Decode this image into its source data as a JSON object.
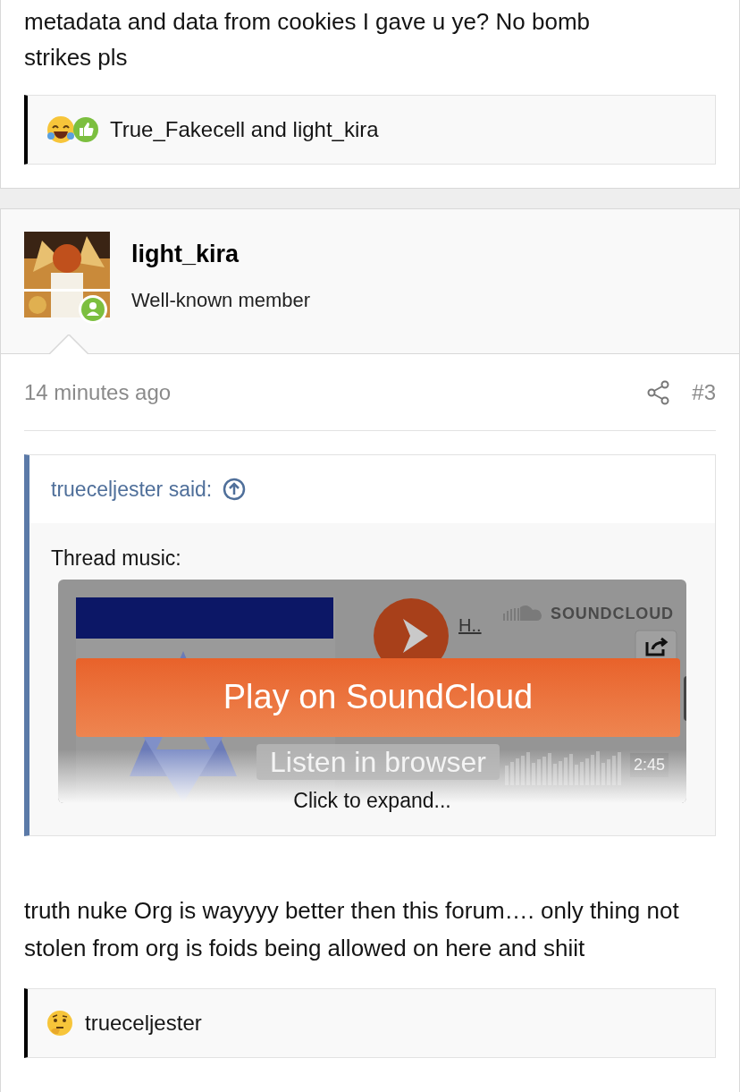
{
  "previous_post": {
    "text_lines": [
      "metadata and data from cookies I gave u ye? No bomb",
      "strikes pls"
    ],
    "reactions": {
      "emojis": [
        {
          "kind": "laugh"
        },
        {
          "kind": "like"
        }
      ],
      "text": "True_Fakecell and light_kira"
    }
  },
  "post": {
    "author": {
      "name": "light_kira",
      "title": "Well-known member",
      "online": true
    },
    "time": "14 minutes ago",
    "number": "#3",
    "quote": {
      "author": "trueceljester said:",
      "label": "Thread music:",
      "embed": {
        "title_link": "H..",
        "brand": "SOUNDCLOUD",
        "play_button": "Play on SoundCloud",
        "duration": "2:45",
        "listen_button": "Listen in browser"
      },
      "expand": "Click to expand..."
    },
    "body": "truth nuke Org is wayyyy better then this forum…. only thing not stolen from org is foids being allowed on here and shiit",
    "reactions": {
      "emojis": [
        {
          "kind": "thinking"
        }
      ],
      "text": "trueceljester"
    }
  }
}
